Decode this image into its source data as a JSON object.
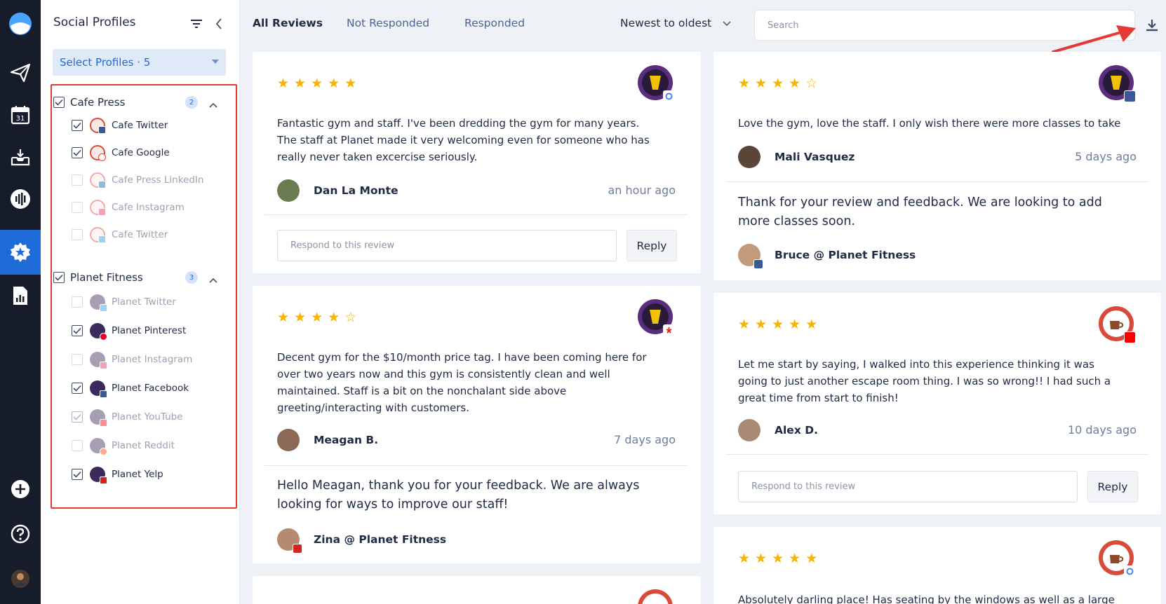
{
  "sidebar": {
    "icons": [
      "logo-icon",
      "send-icon",
      "calendar-icon",
      "inbox-icon",
      "listening-icon",
      "reviews-icon",
      "reports-icon",
      "add-icon",
      "help-icon",
      "user-avatar"
    ],
    "calendar_day": "31"
  },
  "profiles_panel": {
    "title": "Social Profiles",
    "select_label": "Select Profiles · 5",
    "groups": [
      {
        "name": "Cafe Press",
        "count": "2",
        "items": [
          {
            "label": "Cafe Twitter",
            "checked": true,
            "network": "facebook"
          },
          {
            "label": "Cafe Google",
            "checked": true,
            "network": "google"
          },
          {
            "label": "Cafe Press LinkedIn",
            "checked": false,
            "network": "linkedin"
          },
          {
            "label": "Cafe Instagram",
            "checked": false,
            "network": "instagram"
          },
          {
            "label": "Cafe Twitter",
            "checked": false,
            "network": "twitter"
          }
        ]
      },
      {
        "name": "Planet Fitness",
        "count": "3",
        "items": [
          {
            "label": "Planet Twitter",
            "checked": false,
            "network": "twitter"
          },
          {
            "label": "Planet Pinterest",
            "checked": true,
            "network": "pinterest"
          },
          {
            "label": "Planet Instagram",
            "checked": false,
            "network": "instagram"
          },
          {
            "label": "Planet Facebook",
            "checked": true,
            "network": "facebook"
          },
          {
            "label": "Planet YouTube",
            "checked": true,
            "network": "youtube"
          },
          {
            "label": "Planet Reddit",
            "checked": false,
            "network": "reddit"
          },
          {
            "label": "Planet Yelp",
            "checked": true,
            "network": "yelp"
          }
        ]
      }
    ]
  },
  "topbar": {
    "tabs": [
      "All Reviews",
      "Not Responded",
      "Responded"
    ],
    "active_tab": "All Reviews",
    "sort_label": "Newest to oldest",
    "search_placeholder": "Search"
  },
  "reviews": {
    "left": [
      {
        "rating": 5,
        "source": "google",
        "brand": "Planet Fitness",
        "text": [
          "Fantastic gym and staff. I've been dredding the gym for many years.",
          "The staff at Planet made it very welcoming even for someone who has",
          "really never taken excercise seriously."
        ],
        "author": "Dan La Monte",
        "time": "an hour ago",
        "respond_placeholder": "Respond to this review",
        "reply_label": "Reply"
      },
      {
        "rating": 4,
        "source": "yelp",
        "brand": "Planet Fitness",
        "text": [
          "Decent gym for the $10/month price tag. I have been coming here for",
          "over two years now and this gym is consistently clean and well",
          "maintained. Staff is a bit on the nonchalant side above",
          "greeting/interacting with customers."
        ],
        "author": "Meagan B.",
        "time": "7 days ago",
        "response": [
          "Hello Meagan, thank you for your feedback. We are always",
          "looking for ways to improve our staff!"
        ],
        "responder": "Zina @ Planet Fitness"
      }
    ],
    "right": [
      {
        "rating": 4,
        "source": "facebook",
        "brand": "Planet Fitness",
        "text": [
          "Love the gym, love the staff. I only wish there were more classes to take"
        ],
        "author": "Mali Vasquez",
        "time": "5 days ago",
        "response": [
          "Thank for your review and feedback. We are looking to add",
          "more classes soon."
        ],
        "responder": "Bruce @ Planet Fitness"
      },
      {
        "rating": 5,
        "source": "youtube",
        "brand": "Cafe Press",
        "text": [
          "Let me start by saying, I walked into this experience thinking it was",
          "going to just another escape room thing. I was so wrong!! I had such a",
          "great time from start to finish!"
        ],
        "author": "Alex D.",
        "time": "10 days ago",
        "respond_placeholder": "Respond to this review",
        "reply_label": "Reply"
      },
      {
        "rating": 5,
        "source": "google",
        "brand": "Cafe Press",
        "text": [
          "Absolutely darling place! Has seating by the windows as well as a large"
        ]
      }
    ]
  },
  "colors": {
    "accent": "#1f6bd8",
    "star": "#f4b400",
    "highlight": "#e53935",
    "rail": "#171c2b"
  }
}
